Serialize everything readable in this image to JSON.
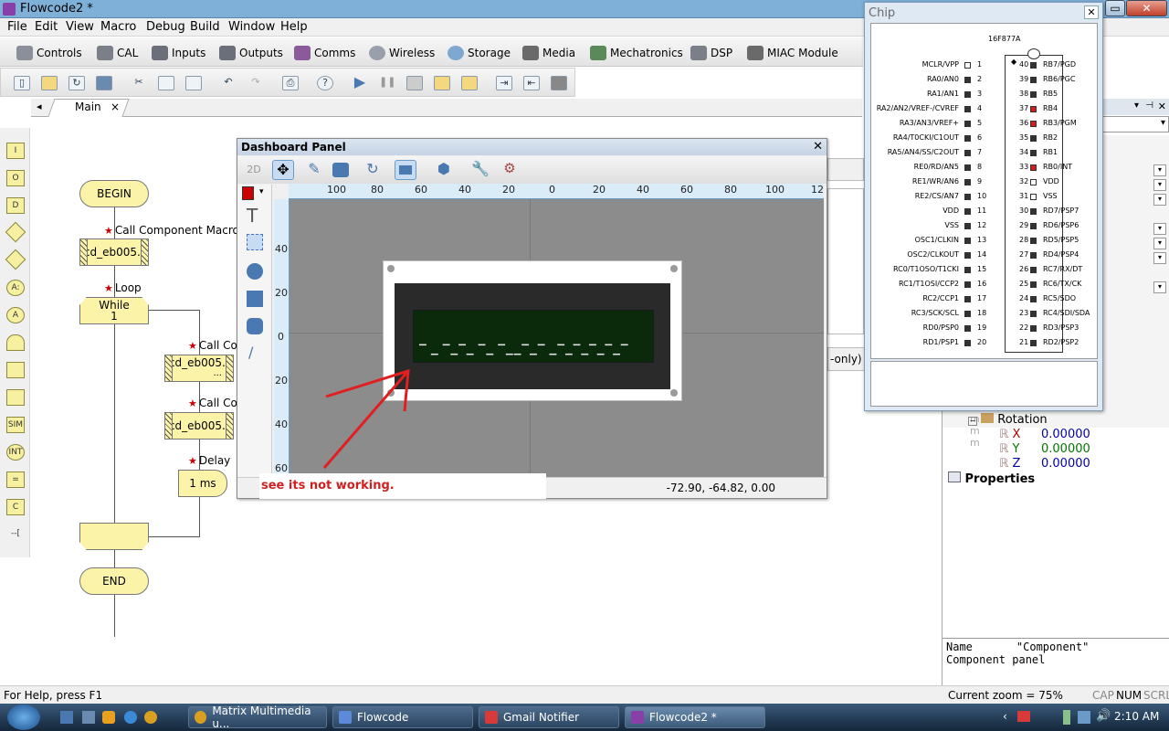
{
  "window": {
    "title": "Flowcode2 *"
  },
  "menu": [
    "File",
    "Edit",
    "View",
    "Macro",
    "Debug",
    "Build",
    "Window",
    "Help"
  ],
  "component_toolbar": [
    "Controls",
    "CAL",
    "Inputs",
    "Outputs",
    "Comms",
    "Wireless",
    "Storage",
    "Media",
    "Mechatronics",
    "DSP",
    "MIAC Module"
  ],
  "tabs": {
    "main": "Main",
    "close": "×"
  },
  "flowchart": {
    "begin": "BEGIN",
    "end": "END",
    "call_label_1": "Call Component Macro",
    "call_box_1": "lcd_eb005...",
    "loop_label": "Loop",
    "while_label": "While",
    "while_cond": "1",
    "call_label_2": "Call Com",
    "call_box_2a": "lcd_eb005...",
    "call_box_2b": "...",
    "call_label_3": "Call Com",
    "call_box_3": "lcd_eb005...",
    "delay_label": "Delay",
    "delay_box": "1 ms"
  },
  "dashboard": {
    "title": "Dashboard Panel",
    "mode_2d": "2D",
    "ruler_top": [
      "100",
      "80",
      "60",
      "40",
      "20",
      "0",
      "20",
      "40",
      "60",
      "80",
      "100",
      "12"
    ],
    "ruler_left": [
      "40",
      "20",
      "0",
      "20",
      "40",
      "60"
    ],
    "lcd_text": "▔ ▁ ▔▁▔▁ ▔▁ ▔▁▁▔▁▔ ▁▔▁▔▁▔▁▔▁▔",
    "note": "see its not working.",
    "coords": "-72.90, -64.82, 0.00"
  },
  "chip": {
    "title": "Chip",
    "name": "16F877A",
    "left_pins": [
      "MCLR/VPP",
      "RA0/AN0",
      "RA1/AN1",
      "RA2/AN2/VREF-/CVREF",
      "RA3/AN3/VREF+",
      "RA4/T0CKI/C1OUT",
      "RA5/AN4/SS/C2OUT",
      "RE0/RD/AN5",
      "RE1/WR/AN6",
      "RE2/CS/AN7",
      "VDD",
      "VSS",
      "OSC1/CLKIN",
      "OSC2/CLKOUT",
      "RC0/T1OSO/T1CKI",
      "RC1/T1OSI/CCP2",
      "RC2/CCP1",
      "RC3/SCK/SCL",
      "RD0/PSP0",
      "RD1/PSP1"
    ],
    "right_pins": [
      "RB7/PGD",
      "RB6/PGC",
      "RB5",
      "RB4",
      "RB3/PGM",
      "RB2",
      "RB1",
      "RB0/INT",
      "VDD",
      "VSS",
      "RD7/PSP7",
      "RD6/PSP6",
      "RD5/PSP5",
      "RD4/PSP4",
      "RC7/RX/DT",
      "RC6/TX/CK",
      "RC5/SDO",
      "RC4/SDI/SDA",
      "RD3/PSP3",
      "RD2/PSP2"
    ],
    "left_nums": [
      "1",
      "2",
      "3",
      "4",
      "5",
      "6",
      "7",
      "8",
      "9",
      "10",
      "11",
      "12",
      "13",
      "14",
      "15",
      "16",
      "17",
      "18",
      "19",
      "20"
    ],
    "right_nums": [
      "40",
      "39",
      "38",
      "37",
      "36",
      "35",
      "34",
      "33",
      "32",
      "31",
      "30",
      "29",
      "28",
      "27",
      "26",
      "25",
      "24",
      "23",
      "22",
      "21"
    ],
    "active_right": [
      3,
      4,
      7
    ]
  },
  "properties": {
    "partial": "-only)",
    "rotation": "Rotation",
    "rx_label": "X",
    "rx_value": "0.00000",
    "ry_label": "Y",
    "ry_value": "0.00000",
    "rz_label": "Z",
    "rz_value": "0.00000",
    "section": "Properties",
    "name_key": "Name",
    "name_val": "\"Component\"",
    "desc": "Component panel"
  },
  "status": {
    "help": "For Help, press F1",
    "zoom": "Current zoom = 75%",
    "cap": "CAP",
    "num": "NUM",
    "scrl": "SCRL"
  },
  "taskbar": {
    "items": [
      "Matrix Multimedia u...",
      "Flowcode",
      "Gmail Notifier",
      "Flowcode2 *"
    ],
    "time": "2:10 AM"
  },
  "colors": {
    "accent_red": "#d02020",
    "flow_fill": "#fbf4a8"
  }
}
